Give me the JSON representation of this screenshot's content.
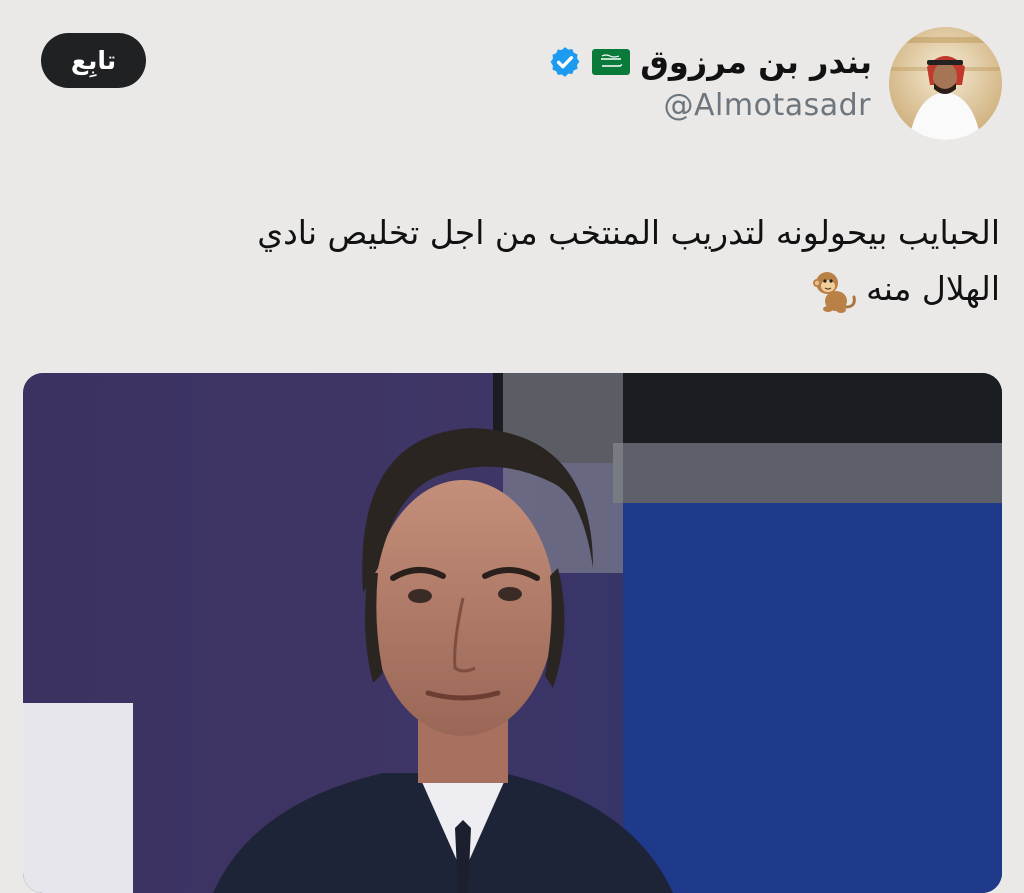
{
  "header": {
    "follow_label": "تابِع",
    "display_name": "بندر بن مرزوق",
    "handle": "@Almotasadr",
    "flag_icon": "saudi-flag-icon",
    "verified_icon": "verified-badge-icon",
    "verified_color": "#1d9bf0"
  },
  "tweet": {
    "line1": "الحبايب بيحولونه لتدريب المنتخب من اجل تخليص نادي",
    "line2": "الهلال منه",
    "emoji_icon": "monkey-icon"
  },
  "colors": {
    "background": "#ebe9e8",
    "button": "#1f2123",
    "handle": "#6e767d"
  }
}
